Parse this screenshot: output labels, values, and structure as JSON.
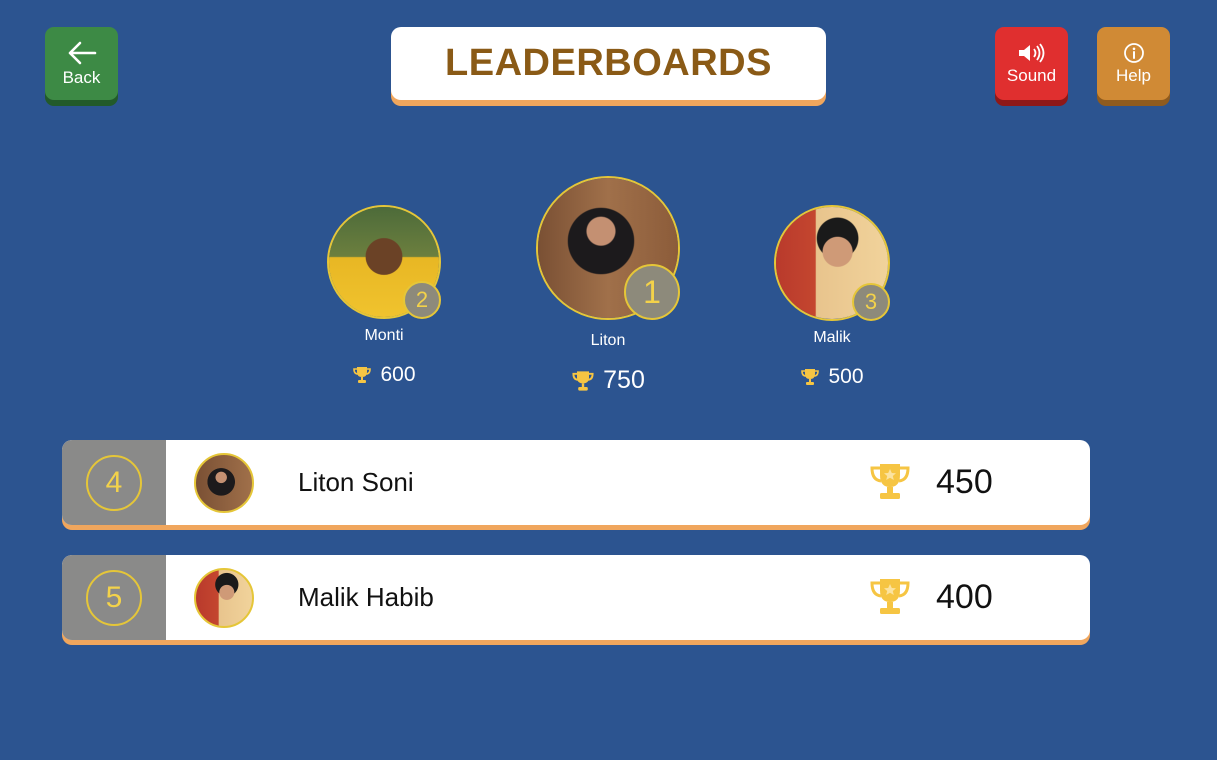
{
  "header": {
    "title": "LEADERBOARDS",
    "back_label": "Back",
    "sound_label": "Sound",
    "help_label": "Help"
  },
  "podium": [
    {
      "rank": "2",
      "name": "Monti",
      "score": "600"
    },
    {
      "rank": "1",
      "name": "Liton",
      "score": "750"
    },
    {
      "rank": "3",
      "name": "Malik",
      "score": "500"
    }
  ],
  "list": [
    {
      "rank": "4",
      "name": "Liton Soni",
      "score": "450"
    },
    {
      "rank": "5",
      "name": "Malik Habib",
      "score": "400"
    }
  ],
  "icons": {
    "back": "arrow-left-icon",
    "sound": "speaker-icon",
    "help": "info-icon",
    "trophy": "trophy-icon"
  },
  "colors": {
    "background": "#2c5490",
    "back_button": "#3d8a45",
    "sound_button": "#e02f2f",
    "help_button": "#d08a35",
    "title_text": "#8a5a16",
    "accent_border": "#f0a65d",
    "avatar_ring": "#e5c638"
  }
}
